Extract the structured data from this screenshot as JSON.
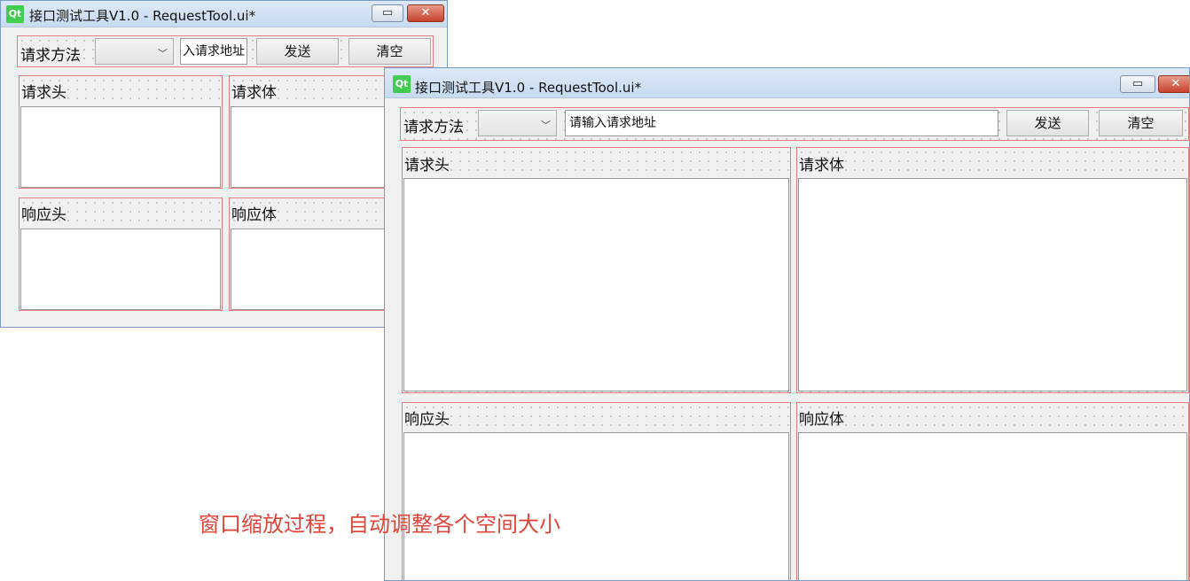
{
  "window_title": "接口测试工具V1.0 - RequestTool.ui*",
  "toolbar": {
    "method_label": "请求方法",
    "method_value": "",
    "url_placeholder": "请输入请求地址",
    "url_partial": "入请求地址",
    "send_label": "发送",
    "clear_label": "清空"
  },
  "panels": {
    "request_header": "请求头",
    "request_body": "请求体",
    "response_header": "响应头",
    "response_body": "响应体"
  },
  "annotation": "窗口缩放过程，自动调整各个空间大小",
  "colors": {
    "frame_border": "#e08080",
    "annotation": "#e0463b"
  },
  "icons": {
    "app": "qt-logo-icon",
    "minimize": "minimize-icon",
    "close": "close-icon",
    "dropdown": "chevron-down-icon"
  }
}
